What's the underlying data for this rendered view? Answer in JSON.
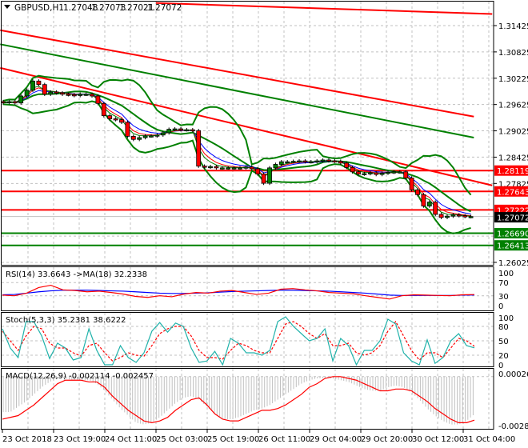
{
  "header": {
    "symbol": "GBPUSD,H1",
    "open": "1.27048",
    "high": "1.27073",
    "low": "1.27021",
    "close": "1.27072"
  },
  "colors": {
    "bull": "#008000",
    "bear": "#ff0000",
    "bands": "#008000",
    "resistance": "#ff0000",
    "support": "#008000",
    "rsi": "#ff0000",
    "rsi_ma": "#0000ff",
    "stoch_main": "#20b2aa",
    "stoch_signal": "#ff0000",
    "macd_hist": "#c0c0c0",
    "macd_signal": "#ff0000",
    "current_price_bg": "#000000"
  },
  "chart_data": [
    {
      "type": "candlestick",
      "price_axis": {
        "ticks": [
          "1.31425",
          "1.30825",
          "1.30225",
          "1.29625",
          "1.29025",
          "1.28425",
          "1.27825",
          "1.26025"
        ],
        "range": [
          1.2585,
          1.3201
        ]
      },
      "time_axis": {
        "ticks": [
          "23 Oct 2018",
          "23 Oct 19:00",
          "24 Oct 11:00",
          "25 Oct 03:00",
          "25 Oct 19:00",
          "26 Oct 11:00",
          "29 Oct 04:00",
          "29 Oct 20:00",
          "30 Oct 12:00",
          "31 Oct 04:00"
        ]
      },
      "grid": true,
      "closes": [
        1.2967,
        1.2969,
        1.2966,
        1.2982,
        1.2995,
        1.3016,
        1.3008,
        1.2986,
        1.2991,
        1.2989,
        1.2986,
        1.2985,
        1.2983,
        1.2986,
        1.2986,
        1.2982,
        1.2965,
        1.2937,
        1.293,
        1.2928,
        1.2922,
        1.289,
        1.2883,
        1.2887,
        1.2891,
        1.2891,
        1.2893,
        1.2898,
        1.2906,
        1.2907,
        1.2905,
        1.2905,
        1.2903,
        1.2822,
        1.282,
        1.2821,
        1.2818,
        1.2818,
        1.2818,
        1.2818,
        1.2818,
        1.282,
        1.2816,
        1.2804,
        1.2783,
        1.2818,
        1.2826,
        1.2832,
        1.2832,
        1.2833,
        1.2834,
        1.2832,
        1.2832,
        1.2834,
        1.2836,
        1.2834,
        1.2833,
        1.2829,
        1.2819,
        1.2809,
        1.2804,
        1.2805,
        1.2807,
        1.2803,
        1.2806,
        1.2808,
        1.2809,
        1.2809,
        1.2795,
        1.2768,
        1.2757,
        1.2731,
        1.274,
        1.2712,
        1.2705,
        1.2708,
        1.2711,
        1.2709,
        1.2707,
        1.2707
      ],
      "trend_lines": [
        {
          "color": "#ff0000",
          "from": [
            25.8,
            1.3194
          ],
          "to": [
            82.6,
            1.3169
          ]
        },
        {
          "color": "#ff0000",
          "from": [
            -0.5,
            1.3132
          ],
          "to": [
            79.5,
            1.2935
          ]
        },
        {
          "color": "#ff0000",
          "from": [
            -0.5,
            1.3046
          ],
          "to": [
            82.6,
            1.2778
          ]
        },
        {
          "color": "#008000",
          "from": [
            -0.5,
            1.31
          ],
          "to": [
            79.5,
            1.2887
          ]
        }
      ],
      "levels": [
        {
          "price": 1.28119,
          "label": "1.28119",
          "color": "#ff0000"
        },
        {
          "price": 1.27643,
          "label": "1.27643",
          "color": "#ff0000"
        },
        {
          "price": 1.27222,
          "label": "1.27222",
          "color": "#ff0000"
        },
        {
          "price": 1.2669,
          "label": "1.26690",
          "color": "#008000"
        },
        {
          "price": 1.26413,
          "label": "1.26413",
          "color": "#008000"
        }
      ],
      "current_price": {
        "price": 1.27072,
        "label": "1.27072"
      }
    },
    {
      "type": "line",
      "title": "RSI(14) 33.6643  ->MA(18) 32.2338",
      "ylim": [
        0,
        100
      ],
      "ticks": [
        "100",
        "70",
        "30",
        "0"
      ],
      "series": [
        {
          "name": "RSI(14)",
          "values": [
            32,
            30,
            38,
            55,
            62,
            48,
            46,
            42,
            44,
            40,
            35,
            28,
            25,
            30,
            27,
            35,
            40,
            38,
            44,
            46,
            40,
            34,
            38,
            50,
            52,
            48,
            45,
            40,
            38,
            36,
            30,
            25,
            20,
            30,
            33,
            32,
            31,
            30,
            33,
            33.6643
          ]
        },
        {
          "name": "MA(18)",
          "values": [
            33,
            34,
            38,
            42,
            45,
            47,
            47,
            47,
            46,
            45,
            44,
            42,
            40,
            38,
            37,
            37,
            38,
            39,
            41,
            43,
            44,
            45,
            46,
            47,
            47,
            46,
            45,
            44,
            42,
            40,
            38,
            35,
            32,
            31,
            31,
            31,
            31,
            31,
            32,
            32.2338
          ]
        }
      ]
    },
    {
      "type": "line",
      "title": "Stoch(5,3,3) 35.2381 38.6222",
      "ylim": [
        0,
        100
      ],
      "ticks": [
        "100",
        "80",
        "50",
        "20",
        "0"
      ],
      "series": [
        {
          "name": "main",
          "values": [
            75,
            35,
            15,
            90,
            90,
            60,
            13,
            45,
            35,
            10,
            15,
            75,
            30,
            0,
            0,
            40,
            15,
            5,
            25,
            70,
            88,
            68,
            87,
            80,
            35,
            5,
            8,
            28,
            0,
            55,
            45,
            25,
            25,
            20,
            30,
            90,
            100,
            80,
            65,
            50,
            55,
            75,
            8,
            55,
            40,
            0,
            30,
            30,
            50,
            95,
            85,
            25,
            8,
            0,
            52,
            3,
            15,
            50,
            65,
            40,
            35.2381
          ]
        },
        {
          "name": "signal",
          "values": [
            70,
            50,
            30,
            60,
            80,
            75,
            45,
            35,
            35,
            25,
            18,
            40,
            45,
            25,
            8,
            15,
            25,
            20,
            18,
            40,
            65,
            75,
            80,
            80,
            60,
            30,
            15,
            15,
            12,
            30,
            45,
            40,
            30,
            25,
            25,
            55,
            85,
            90,
            80,
            65,
            55,
            65,
            40,
            40,
            45,
            25,
            20,
            25,
            40,
            70,
            90,
            60,
            30,
            10,
            25,
            25,
            15,
            35,
            55,
            50,
            38.6222
          ]
        }
      ]
    },
    {
      "type": "bar+line",
      "title": "MACD(12,26,9) -0.002114 -0.002457",
      "ylim": [
        -0.002809,
        0.000262
      ],
      "ticks": [
        "0.000262",
        "-0.002809"
      ],
      "series": [
        {
          "name": "MACD",
          "values": [
            -0.002,
            -0.002,
            -0.0017,
            -0.0014,
            -0.001,
            -0.0006,
            -0.0003,
            -0.0001,
            -0.0001,
            -0.0002,
            -0.0002,
            -0.0002,
            -0.0004,
            -0.0008,
            -0.0013,
            -0.0018,
            -0.0022,
            -0.0026,
            -0.0027,
            -0.0026,
            -0.0023,
            -0.0019,
            -0.0015,
            -0.0012,
            -0.0011,
            -0.0013,
            -0.0017,
            -0.0021,
            -0.0024,
            -0.0024,
            -0.0023,
            -0.0021,
            -0.0019,
            -0.0018,
            -0.0016,
            -0.0013,
            -0.001,
            -0.0007,
            -0.0004,
            -0.0002,
            -0.0001,
            -0.0001,
            -0.0001,
            -0.0002,
            -0.0003,
            -0.0005,
            -0.0007,
            -0.0008,
            -0.0008,
            -0.0006,
            -0.0005,
            -0.0006,
            -0.0009,
            -0.0013,
            -0.0018,
            -0.0022,
            -0.0025,
            -0.0027,
            -0.0027,
            -0.0025,
            -0.002114
          ]
        },
        {
          "name": "Signal",
          "values": [
            -0.0024,
            -0.0023,
            -0.0022,
            -0.0019,
            -0.0016,
            -0.0012,
            -0.0008,
            -0.0004,
            -0.0002,
            -0.0002,
            -0.0002,
            -0.0003,
            -0.0003,
            -0.0006,
            -0.0011,
            -0.0015,
            -0.0019,
            -0.0022,
            -0.0025,
            -0.0026,
            -0.0025,
            -0.0023,
            -0.0019,
            -0.0016,
            -0.0013,
            -0.0012,
            -0.0016,
            -0.0021,
            -0.0024,
            -0.0025,
            -0.0025,
            -0.0023,
            -0.0021,
            -0.0019,
            -0.0019,
            -0.0018,
            -0.0016,
            -0.0013,
            -0.001,
            -0.0006,
            -0.0004,
            -0.0001,
            0.0,
            0.0,
            -0.0001,
            -0.0002,
            -0.0004,
            -0.0006,
            -0.0008,
            -0.0008,
            -0.0007,
            -0.0007,
            -0.0008,
            -0.0011,
            -0.0014,
            -0.0018,
            -0.0021,
            -0.0024,
            -0.0026,
            -0.0026,
            -0.002457
          ]
        }
      ]
    }
  ]
}
